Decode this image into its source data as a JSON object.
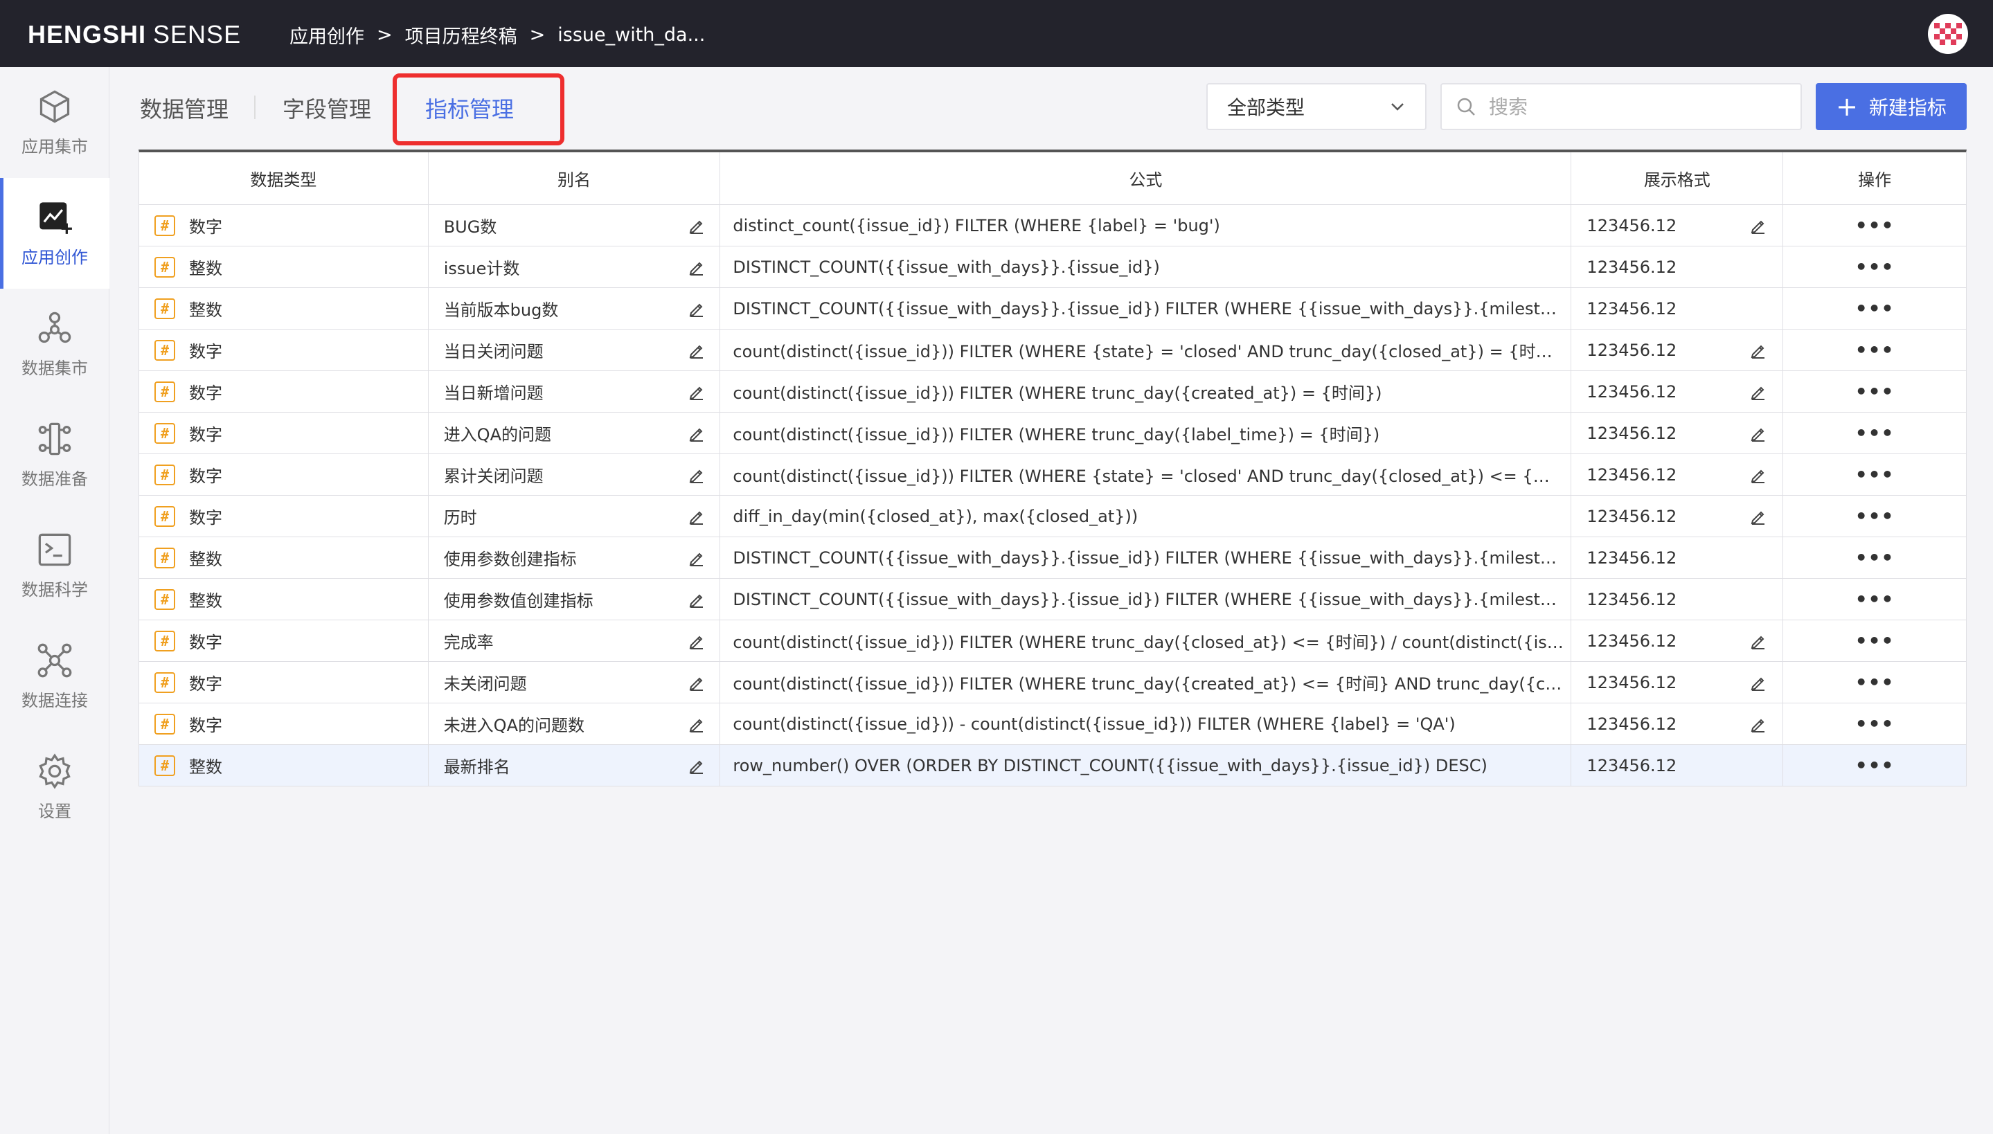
{
  "header": {
    "brand_bold": "HENGSHI",
    "brand_light": "SENSE",
    "breadcrumb": [
      "应用创作",
      "项目历程终稿",
      "issue_with_da..."
    ],
    "breadcrumb_sep": ">"
  },
  "sidebar": {
    "items": [
      {
        "label": "应用集市",
        "icon": "cube-icon"
      },
      {
        "label": "应用创作",
        "icon": "chart-create-icon",
        "active": true
      },
      {
        "label": "数据集市",
        "icon": "molecule-icon"
      },
      {
        "label": "数据准备",
        "icon": "flow-icon"
      },
      {
        "label": "数据科学",
        "icon": "terminal-icon"
      },
      {
        "label": "数据连接",
        "icon": "network-icon"
      },
      {
        "label": "设置",
        "icon": "gear-icon"
      }
    ]
  },
  "tabs": [
    {
      "label": "数据管理"
    },
    {
      "label": "字段管理"
    },
    {
      "label": "指标管理",
      "active": true
    }
  ],
  "toolbar": {
    "type_filter": "全部类型",
    "search_placeholder": "搜索",
    "new_button": "新建指标",
    "accent": "#4a6fe3",
    "highlight_color": "#ee2e2e"
  },
  "table": {
    "columns": [
      "数据类型",
      "别名",
      "公式",
      "展示格式",
      "操作"
    ],
    "rows": [
      {
        "type": "数字",
        "alias": "BUG数",
        "formula": "distinct_count({issue_id}) FILTER (WHERE {label} = 'bug')",
        "format": "123456.12",
        "format_editable": true
      },
      {
        "type": "整数",
        "alias": "issue计数",
        "formula": "DISTINCT_COUNT({{issue_with_days}}.{issue_id})",
        "format": "123456.12",
        "format_editable": false
      },
      {
        "type": "整数",
        "alias": "当前版本bug数",
        "formula": "DISTINCT_COUNT({{issue_with_days}}.{issue_id}) FILTER (WHERE {{issue_with_days}}.{milestone} = {{%...",
        "format": "123456.12",
        "format_editable": false
      },
      {
        "type": "数字",
        "alias": "当日关闭问题",
        "formula": "count(distinct({issue_id})) FILTER (WHERE {state} = 'closed' AND trunc_day({closed_at}) = {时间})",
        "format": "123456.12",
        "format_editable": true
      },
      {
        "type": "数字",
        "alias": "当日新增问题",
        "formula": "count(distinct({issue_id})) FILTER (WHERE trunc_day({created_at}) = {时间})",
        "format": "123456.12",
        "format_editable": true
      },
      {
        "type": "数字",
        "alias": "进入QA的问题",
        "formula": "count(distinct({issue_id})) FILTER (WHERE trunc_day({label_time}) = {时间})",
        "format": "123456.12",
        "format_editable": true
      },
      {
        "type": "数字",
        "alias": "累计关闭问题",
        "formula": "count(distinct({issue_id})) FILTER (WHERE {state} = 'closed' AND trunc_day({closed_at}) <= {时间})",
        "format": "123456.12",
        "format_editable": true
      },
      {
        "type": "数字",
        "alias": "历时",
        "formula": "diff_in_day(min({closed_at}), max({closed_at}))",
        "format": "123456.12",
        "format_editable": true
      },
      {
        "type": "整数",
        "alias": "使用参数创建指标",
        "formula": "DISTINCT_COUNT({{issue_with_days}}.{issue_id}) FILTER (WHERE {{issue_with_days}}.{milestone} = {{%...",
        "format": "123456.12",
        "format_editable": false
      },
      {
        "type": "整数",
        "alias": "使用参数值创建指标",
        "formula": "DISTINCT_COUNT({{issue_with_days}}.{issue_id}) FILTER (WHERE {{issue_with_days}}.{milestone} = '{{%...",
        "format": "123456.12",
        "format_editable": false
      },
      {
        "type": "数字",
        "alias": "完成率",
        "formula": "count(distinct({issue_id})) FILTER (WHERE trunc_day({closed_at}) <= {时间}) / count(distinct({issue_id}))...",
        "format": "123456.12",
        "format_editable": true
      },
      {
        "type": "数字",
        "alias": "未关闭问题",
        "formula": "count(distinct({issue_id})) FILTER (WHERE trunc_day({created_at}) <= {时间} AND trunc_day({closed_at}...",
        "format": "123456.12",
        "format_editable": true
      },
      {
        "type": "数字",
        "alias": "未进入QA的问题数",
        "formula": "count(distinct({issue_id})) - count(distinct({issue_id})) FILTER (WHERE {label} = 'QA')",
        "format": "123456.12",
        "format_editable": true
      },
      {
        "type": "整数",
        "alias": "最新排名",
        "formula": "row_number() OVER (ORDER BY DISTINCT_COUNT({{issue_with_days}}.{issue_id}) DESC)",
        "format": "123456.12",
        "format_editable": false,
        "highlighted": true
      }
    ],
    "type_badge": "#",
    "more_label": "•••"
  }
}
